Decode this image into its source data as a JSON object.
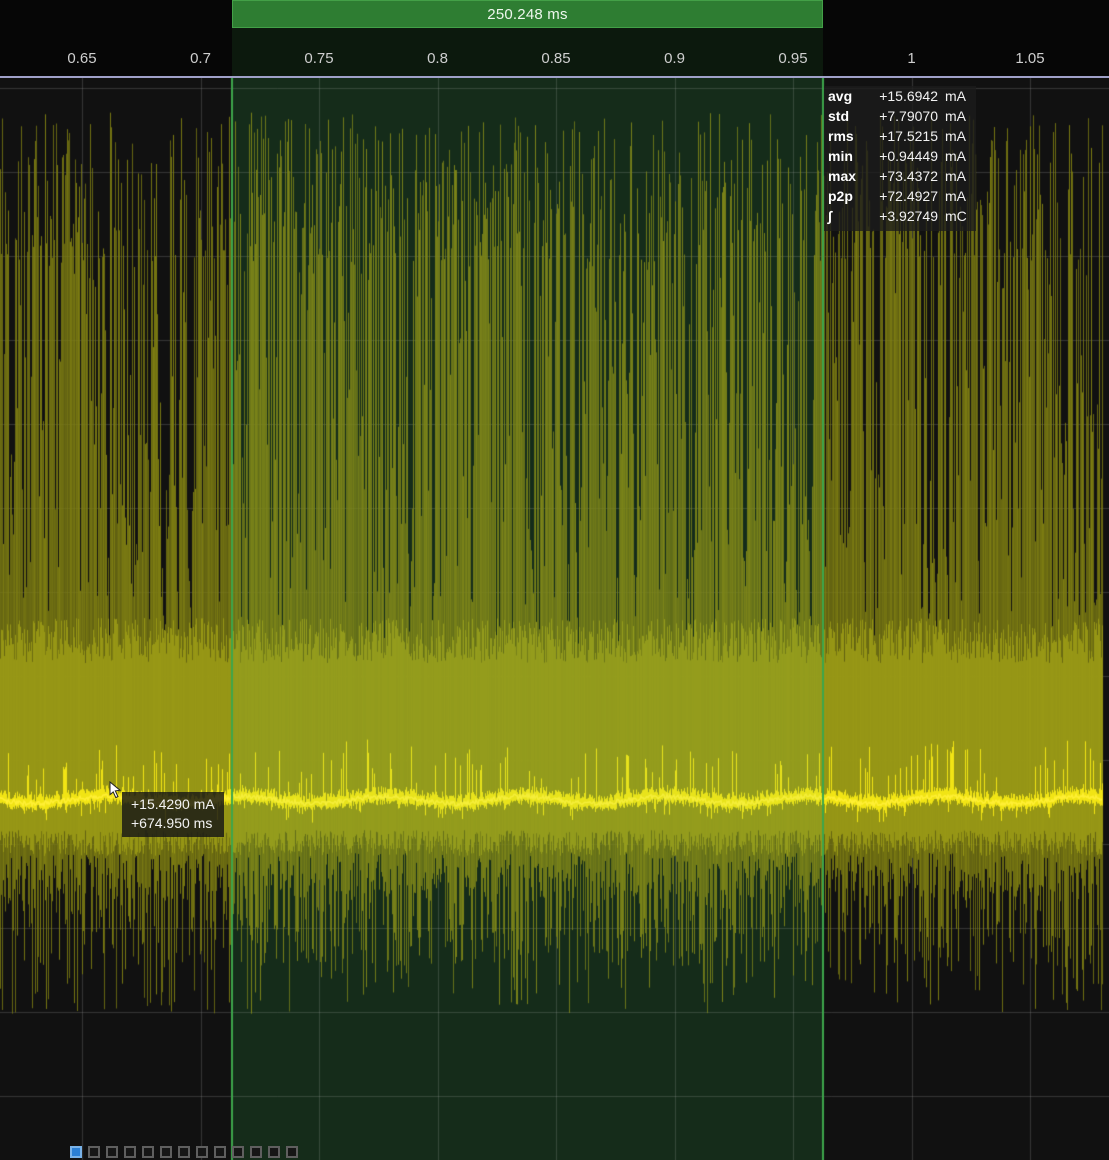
{
  "selection": {
    "duration_label": "250.248 ms"
  },
  "axis": {
    "ticks": [
      "0.65",
      "0.7",
      "0.75",
      "0.8",
      "0.85",
      "0.9",
      "0.95",
      "1",
      "1.05"
    ]
  },
  "stats": {
    "rows": [
      {
        "label": "avg",
        "value": "+15.6942",
        "unit": "mA"
      },
      {
        "label": "std",
        "value": "+7.79070",
        "unit": "mA"
      },
      {
        "label": "rms",
        "value": "+17.5215",
        "unit": "mA"
      },
      {
        "label": "min",
        "value": "+0.94449",
        "unit": "mA"
      },
      {
        "label": "max",
        "value": "+73.4372",
        "unit": "mA"
      },
      {
        "label": "p2p",
        "value": "+72.4927",
        "unit": "mA"
      },
      {
        "label": "∫",
        "value": "+3.92749",
        "unit": "mC"
      }
    ]
  },
  "tooltip": {
    "current": "+15.4290 mA",
    "time": "+674.950 ms"
  },
  "toggles": {
    "count": 13,
    "active_index": 0
  },
  "chart": {
    "type": "line",
    "x_unit": "s",
    "y_unit": "mA",
    "x_ticks": [
      0.65,
      0.7,
      0.75,
      0.8,
      0.85,
      0.9,
      0.95,
      1,
      1.05
    ],
    "selection_summary": {
      "duration_ms": 250.248,
      "avg_mA": 15.6942,
      "std_mA": 7.7907,
      "rms_mA": 17.5215,
      "min_mA": 0.94449,
      "max_mA": 73.4372,
      "p2p_mA": 72.4927,
      "charge_mC": 3.92749
    },
    "seed": 9173,
    "colors": {
      "background": "#111111",
      "selection_bg": "#0e1f13",
      "grid": "rgba(150,150,150,0.27)",
      "waveform": "#7f7f12",
      "waveform_bright": "#9c9c16",
      "average": "#f6e814",
      "average_line": "#ffef35",
      "selection_green": "#2e7d32",
      "selection_border": "#3da64b",
      "axis_line": "#9fa0c8",
      "tick_text": "#cfcfcf",
      "toggle_active": "#2b7fd4"
    }
  }
}
